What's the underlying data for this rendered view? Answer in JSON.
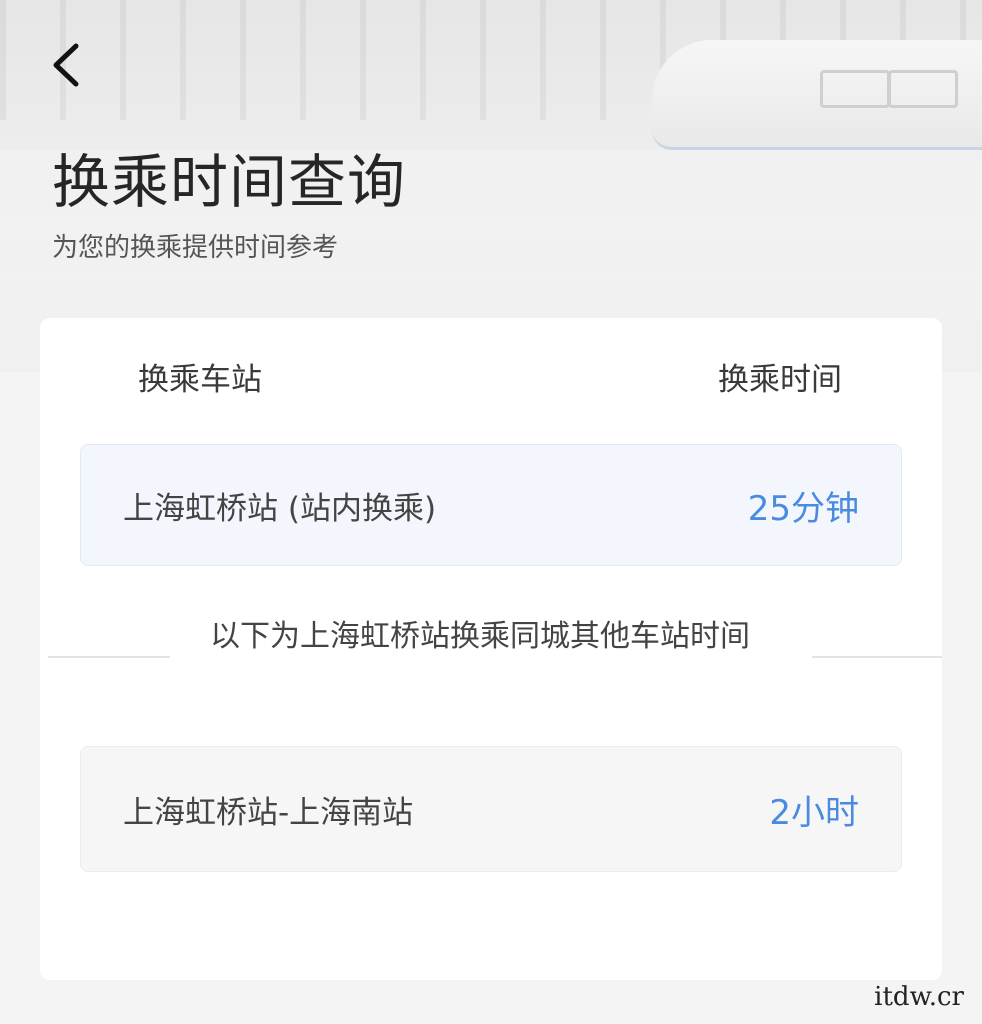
{
  "header": {
    "back_icon": "chevron-left-icon",
    "title": "换乘时间查询",
    "subtitle": "为您的换乘提供时间参考"
  },
  "table": {
    "col_station": "换乘车站",
    "col_time": "换乘时间",
    "rows": [
      {
        "station": "上海虹桥站 (站内换乘)",
        "time": "25分钟"
      },
      {
        "station": "上海虹桥站-上海南站",
        "time": "2小时"
      }
    ],
    "divider_text": "以下为上海虹桥站换乘同城其他车站时间"
  },
  "accent_color": "#4a8be0",
  "watermark": "itdw.cr"
}
